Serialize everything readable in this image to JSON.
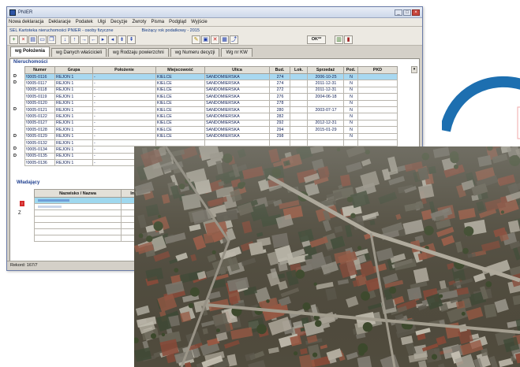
{
  "window": {
    "title": "PNIER",
    "menu": [
      "Nowa deklaracja",
      "Deklaracje",
      "Podatek",
      "Ulgi",
      "Decyzje",
      "Zwroty",
      "Pisma",
      "Podgląd",
      "Wyjście"
    ],
    "info_left": "SEL Kartoteka nieruchomości PNIER - osoby fizyczne",
    "info_right": "Bieżący rok podatkowy - 2015",
    "ok_label": "OK**",
    "status": "Rekord: 167/7"
  },
  "tabs": [
    "wg Położenia",
    "wg Danych właścicieli",
    "wg Rodzaju powierzchni",
    "wg Numeru decyzji",
    "Wg nr KW"
  ],
  "properties": {
    "section_title": "Nieruchomości",
    "columns": [
      "Numer",
      "Grupa",
      "Położenie",
      "Miejscowość",
      "Ulica",
      "Bud.",
      "Lok.",
      "Sprzedaż",
      "Pod.",
      "PKD"
    ],
    "gutter": [
      "D",
      "D",
      "",
      "",
      "",
      "D",
      "",
      "",
      "",
      "D",
      "",
      "D",
      "D",
      ""
    ],
    "rows": [
      [
        "!0005-0116",
        "REJON 1",
        "-",
        "KIELCE",
        "SANDOMIERSKA",
        "274",
        "",
        "2006-10-25",
        "N",
        ""
      ],
      [
        "!0005-0117",
        "REJON 1",
        "-",
        "KIELCE",
        "SANDOMIERSKA",
        "274",
        "",
        "2011-12-31",
        "N",
        ""
      ],
      [
        "!0005-0118",
        "REJON 1",
        "-",
        "KIELCE",
        "SANDOMIERSKA",
        "272",
        "",
        "2011-12-31",
        "N",
        ""
      ],
      [
        "!0005-0119",
        "REJON 1",
        "-",
        "KIELCE",
        "SANDOMIERSKA",
        "276",
        "",
        "2004-06-18",
        "N",
        ""
      ],
      [
        "!0005-0120",
        "REJON 1",
        "-",
        "KIELCE",
        "SANDOMIERSKA",
        "278",
        "",
        "",
        "N",
        ""
      ],
      [
        "!0005-0121",
        "REJON 1",
        "-",
        "KIELCE",
        "SANDOMIERSKA",
        "280",
        "",
        "2003-07-17",
        "N",
        ""
      ],
      [
        "!0005-0122",
        "REJON 1",
        "-",
        "KIELCE",
        "SANDOMIERSKA",
        "282",
        "",
        "",
        "N",
        ""
      ],
      [
        "!0005-0127",
        "REJON 1",
        "-",
        "KIELCE",
        "SANDOMIERSKA",
        "292",
        "",
        "2012-12-31",
        "N",
        ""
      ],
      [
        "!0005-0128",
        "REJON 1",
        "-",
        "KIELCE",
        "SANDOMIERSKA",
        "294",
        "",
        "2015-01-29",
        "N",
        ""
      ],
      [
        "!0005-0129",
        "REJON 1",
        "-",
        "KIELCE",
        "SANDOMIERSKA",
        "298",
        "",
        "",
        "N",
        ""
      ],
      [
        "!0005-0132",
        "REJON 1",
        "-",
        "",
        "",
        "",
        "",
        "",
        "",
        ""
      ],
      [
        "!0005-0134",
        "REJON 1",
        "-",
        "",
        "",
        "",
        "",
        "",
        "",
        ""
      ],
      [
        "!0005-0135",
        "REJON 1",
        "-",
        "",
        "",
        "",
        "",
        "",
        "",
        ""
      ],
      [
        "!0005-0136",
        "REJON 1",
        "-",
        "",
        "",
        "",
        "",
        "",
        "",
        ""
      ]
    ]
  },
  "owners": {
    "section_title": "Władający",
    "columns": [
      "Nazwisko / Nazwa",
      "Im"
    ],
    "marker": "Z"
  },
  "colors": {
    "selected_row": "#a8d8f0",
    "section_title": "#1f3f8f",
    "arrow": "#1d6fb0"
  }
}
